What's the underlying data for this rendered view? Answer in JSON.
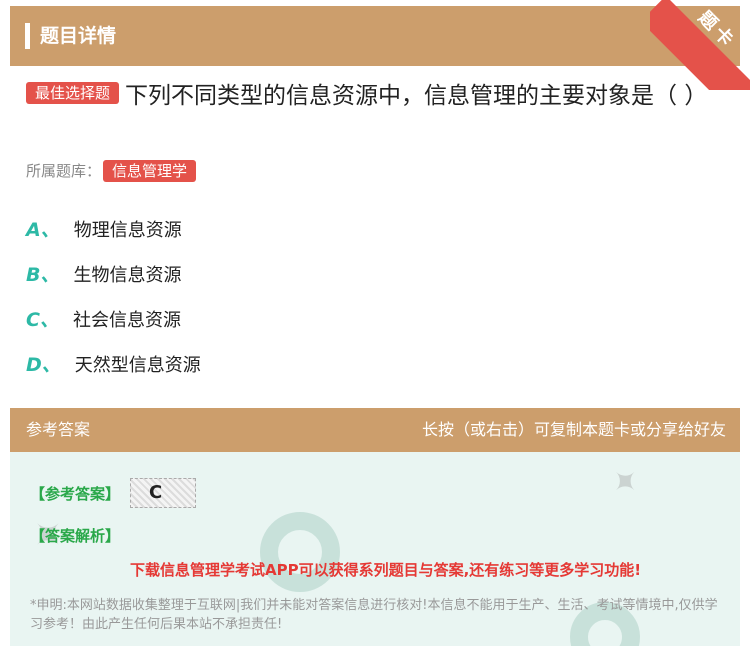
{
  "header": {
    "title": "题目详情",
    "corner_label": "题卡"
  },
  "question": {
    "tag": "最佳选择题",
    "text": "下列不同类型的信息资源中，信息管理的主要对象是（ ）",
    "bank_label": "所属题库：",
    "bank_name": "信息管理学"
  },
  "options": [
    {
      "letter": "A、",
      "text": "物理信息资源"
    },
    {
      "letter": "B、",
      "text": "生物信息资源"
    },
    {
      "letter": "C、",
      "text": "社会信息资源"
    },
    {
      "letter": "D、",
      "text": "天然型信息资源"
    }
  ],
  "answer_section": {
    "title": "参考答案",
    "hint": "长按（或右击）可复制本题卡或分享给好友",
    "answer_label": "【参考答案】",
    "answer_value": "C",
    "analysis_label": "【答案解析】",
    "promo": "下载信息管理学考试APP可以获得系列题目与答案,还有练习等更多学习功能!",
    "disclaimer": "*申明:本网站数据收集整理于互联网|我们并未能对答案信息进行核对!本信息不能用于生产、生活、考试等情境中,仅供学习参考！由此产生任何后果本站不承担责任!"
  },
  "colors": {
    "header": "#cc9e6c",
    "tag": "#e4524a",
    "option_letter": "#2db9a6",
    "answer_label": "#2aa84a",
    "promo": "#e53935",
    "answer_bg": "#e9f5f2"
  }
}
